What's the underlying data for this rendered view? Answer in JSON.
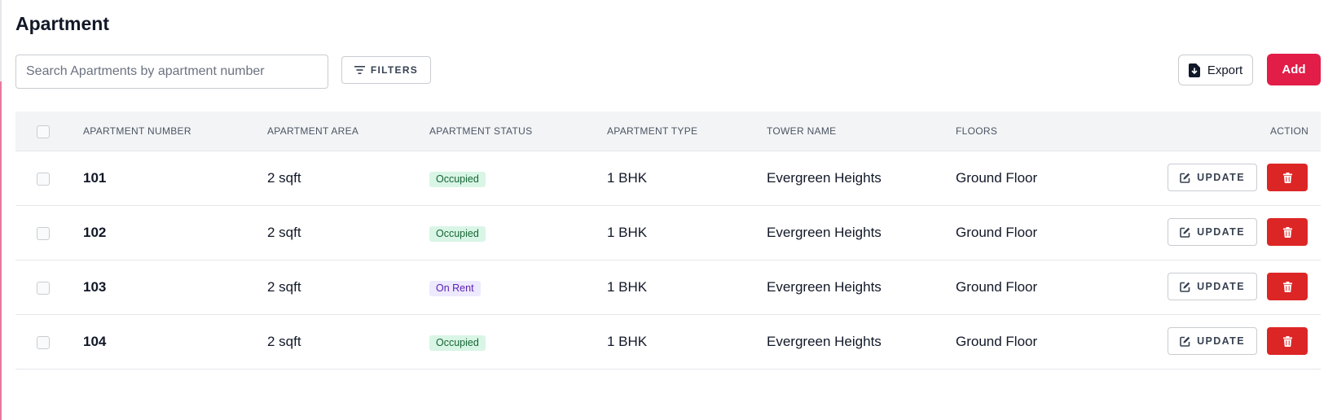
{
  "page": {
    "title": "Apartment"
  },
  "search": {
    "placeholder": "Search Apartments by apartment number",
    "value": ""
  },
  "toolbar": {
    "filters_label": "FILTERS",
    "export_label": "Export",
    "add_label": "Add"
  },
  "table": {
    "columns": [
      "APARTMENT NUMBER",
      "APARTMENT AREA",
      "APARTMENT STATUS",
      "APARTMENT TYPE",
      "TOWER NAME",
      "FLOORS",
      "ACTION"
    ],
    "rows": [
      {
        "number": "101",
        "area": "2 sqft",
        "status": "Occupied",
        "type": "1 BHK",
        "tower": "Evergreen Heights",
        "floor": "Ground Floor",
        "update_label": "UPDATE"
      },
      {
        "number": "102",
        "area": "2 sqft",
        "status": "Occupied",
        "type": "1 BHK",
        "tower": "Evergreen Heights",
        "floor": "Ground Floor",
        "update_label": "UPDATE"
      },
      {
        "number": "103",
        "area": "2 sqft",
        "status": "On Rent",
        "type": "1 BHK",
        "tower": "Evergreen Heights",
        "floor": "Ground Floor",
        "update_label": "UPDATE"
      },
      {
        "number": "104",
        "area": "2 sqft",
        "status": "Occupied",
        "type": "1 BHK",
        "tower": "Evergreen Heights",
        "floor": "Ground Floor",
        "update_label": "UPDATE"
      }
    ]
  },
  "colors": {
    "accent": "#e11d48",
    "delete": "#dc2626",
    "occupied_bg": "#d9f5e6",
    "occupied_text": "#166534",
    "rent_bg": "#ede9fe",
    "rent_text": "#5b21b6"
  },
  "icons": {
    "filters": "filter-lines-icon",
    "export": "file-download-icon",
    "update": "edit-icon",
    "delete": "trash-icon"
  }
}
